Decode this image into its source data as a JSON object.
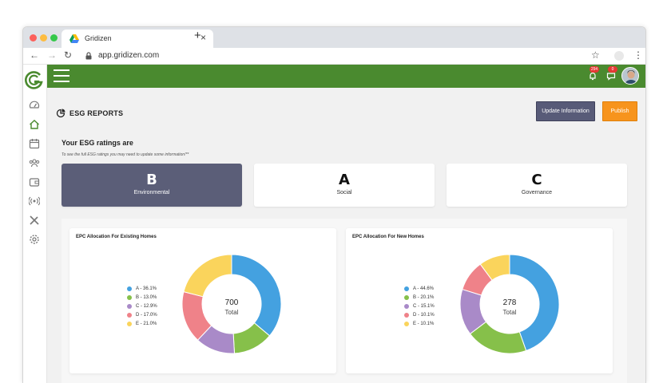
{
  "browser": {
    "tab_title": "Gridizen",
    "url": "app.gridizen.com"
  },
  "topbar": {
    "notification_count": "294",
    "message_count": "0"
  },
  "page": {
    "title": "ESG REPORTS",
    "update_button": "Update Information",
    "publish_button": "Publish"
  },
  "ratings": {
    "heading": "Your ESG ratings are",
    "note": "To see the full ESG ratings you may need to update some information!**",
    "items": [
      {
        "letter": "B",
        "label": "Environmental"
      },
      {
        "letter": "A",
        "label": "Social"
      },
      {
        "letter": "C",
        "label": "Governance"
      }
    ]
  },
  "colors": {
    "brand_green": "#4a8a2f",
    "A": "#44a1e0",
    "B": "#86c04a",
    "C": "#a98ac8",
    "D": "#ef8289",
    "E": "#fad45c"
  },
  "chart_data": [
    {
      "type": "pie",
      "title": "EPC Allocation For Existing Homes",
      "legend": [
        "A - 36.1%",
        "B - 13.0%",
        "C - 12.9%",
        "D - 17.0%",
        "E - 21.0%"
      ],
      "values": [
        36.1,
        13.0,
        12.9,
        17.0,
        21.0
      ],
      "center_value": "700",
      "center_label": "Total"
    },
    {
      "type": "pie",
      "title": "EPC Allocation For New Homes",
      "legend": [
        "A - 44.6%",
        "B - 20.1%",
        "C - 15.1%",
        "D - 10.1%",
        "E - 10.1%"
      ],
      "values": [
        44.6,
        20.1,
        15.1,
        10.1,
        10.1
      ],
      "center_value": "278",
      "center_label": "Total"
    }
  ]
}
